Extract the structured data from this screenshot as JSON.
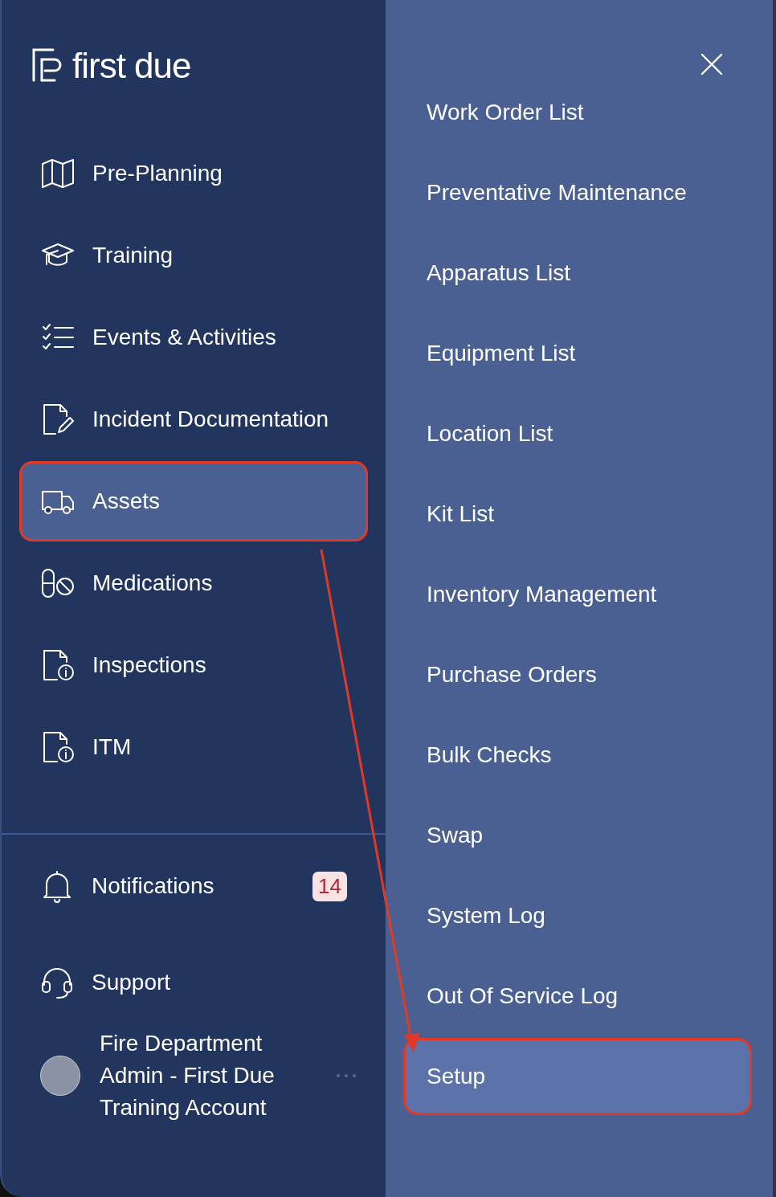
{
  "logo": {
    "text": "first due"
  },
  "nav": [
    {
      "label": "Pre-Planning",
      "kind": "map",
      "selected": false,
      "annotated": false
    },
    {
      "label": "Training",
      "kind": "cap",
      "selected": false,
      "annotated": false
    },
    {
      "label": "Events & Activities",
      "kind": "checklist",
      "selected": false,
      "annotated": false
    },
    {
      "label": "Incident Documentation",
      "kind": "docedit",
      "selected": false,
      "annotated": false
    },
    {
      "label": "Assets",
      "kind": "truck",
      "selected": true,
      "annotated": true
    },
    {
      "label": "Medications",
      "kind": "pills",
      "selected": false,
      "annotated": false
    },
    {
      "label": "Inspections",
      "kind": "docinfo",
      "selected": false,
      "annotated": false
    },
    {
      "label": "ITM",
      "kind": "docinfo",
      "selected": false,
      "annotated": false
    }
  ],
  "bottom": [
    {
      "label": "Notifications",
      "kind": "bell",
      "badge": "14"
    },
    {
      "label": "Support",
      "kind": "headset"
    }
  ],
  "user": {
    "name": "Fire Department Admin - First Due Training Account"
  },
  "submenu": [
    {
      "label": "Work Order List",
      "selected": false,
      "annotated": false
    },
    {
      "label": "Preventative Maintenance",
      "selected": false,
      "annotated": false
    },
    {
      "label": "Apparatus List",
      "selected": false,
      "annotated": false
    },
    {
      "label": "Equipment List",
      "selected": false,
      "annotated": false
    },
    {
      "label": "Location List",
      "selected": false,
      "annotated": false
    },
    {
      "label": "Kit List",
      "selected": false,
      "annotated": false
    },
    {
      "label": "Inventory Management",
      "selected": false,
      "annotated": false
    },
    {
      "label": "Purchase Orders",
      "selected": false,
      "annotated": false
    },
    {
      "label": "Bulk Checks",
      "selected": false,
      "annotated": false
    },
    {
      "label": "Swap",
      "selected": false,
      "annotated": false
    },
    {
      "label": "System Log",
      "selected": false,
      "annotated": false
    },
    {
      "label": "Out Of Service Log",
      "selected": false,
      "annotated": false
    },
    {
      "label": "Setup",
      "selected": true,
      "annotated": true
    }
  ],
  "annotation_arrow": true
}
